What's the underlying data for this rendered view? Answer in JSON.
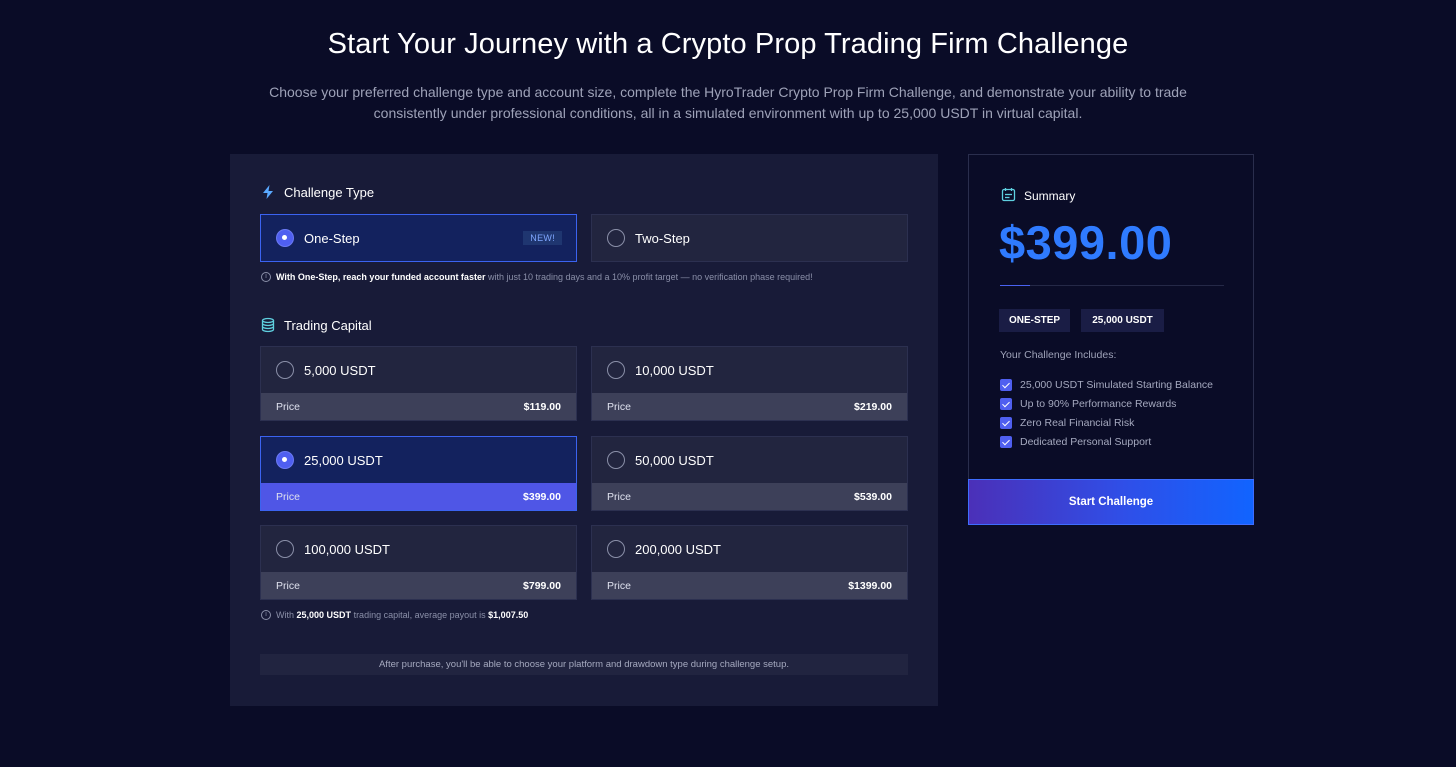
{
  "hero": {
    "title": "Start Your Journey with a Crypto Prop Trading Firm Challenge",
    "subtitle": "Choose your preferred challenge type and account size, complete the HyroTrader Crypto Prop Firm Challenge, and demonstrate your ability to trade consistently under professional conditions, all in a simulated environment with up to 25,000 USDT in virtual capital."
  },
  "challenge_type": {
    "heading": "Challenge Type",
    "icon": "lightning-icon",
    "options": [
      {
        "label": "One-Step",
        "badge": "NEW!",
        "selected": true
      },
      {
        "label": "Two-Step",
        "selected": false
      }
    ],
    "info_bold": "With One-Step, reach your funded account faster",
    "info_rest": "with just 10 trading days and a 10% profit target — no verification phase required!"
  },
  "trading_capital": {
    "heading": "Trading Capital",
    "icon": "coins-stack-icon",
    "price_label": "Price",
    "options": [
      {
        "amount": "5,000 USDT",
        "price": "$119.00",
        "selected": false
      },
      {
        "amount": "10,000 USDT",
        "price": "$219.00",
        "selected": false
      },
      {
        "amount": "25,000 USDT",
        "price": "$399.00",
        "selected": true
      },
      {
        "amount": "50,000 USDT",
        "price": "$539.00",
        "selected": false
      },
      {
        "amount": "100,000 USDT",
        "price": "$799.00",
        "selected": false
      },
      {
        "amount": "200,000 USDT",
        "price": "$1399.00",
        "selected": false
      }
    ],
    "payout_prefix": "With",
    "payout_capital": "25,000 USDT",
    "payout_middle": "trading capital, average payout is",
    "payout_value": "$1,007.50"
  },
  "footer_note": "After purchase, you'll be able to choose your platform and drawdown type during challenge setup.",
  "summary": {
    "heading": "Summary",
    "icon": "calendar-icon",
    "total": "$399.00",
    "tags": [
      "ONE-STEP",
      "25,000 USDT"
    ],
    "includes_title": "Your Challenge Includes:",
    "includes": [
      "25,000 USDT Simulated Starting Balance",
      "Up to 90% Performance Rewards",
      "Zero Real Financial Risk",
      "Dedicated Personal Support"
    ],
    "cta": "Start Challenge"
  },
  "colors": {
    "background": "#0a0c27",
    "panel": "#181b38",
    "accent_blue": "#2f7bff",
    "selected_border": "#3b63f0",
    "selected_price_bar": "#4f56e6"
  }
}
